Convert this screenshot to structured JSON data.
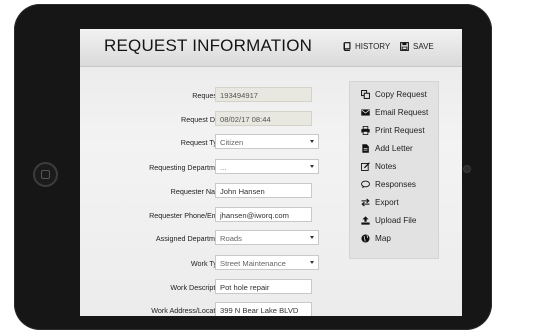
{
  "header": {
    "title": "REQUEST INFORMATION",
    "history_label": "HISTORY",
    "save_label": "SAVE"
  },
  "form": {
    "fields": [
      {
        "label": "Request #:",
        "value": "193494917",
        "kind": "readonly"
      },
      {
        "label": "Request Date:",
        "value": "08/02/17 08:44",
        "kind": "readonly"
      },
      {
        "label": "Request Type:",
        "value": "Citizen",
        "kind": "select"
      },
      {
        "label": "Requesting Department:",
        "value": "...",
        "kind": "select"
      },
      {
        "label": "Requester Name:",
        "value": "John Hansen",
        "kind": "text"
      },
      {
        "label": "Requester Phone/Email:",
        "value": "jhansen@iworq.com",
        "kind": "text"
      },
      {
        "label": "Assigned Department:",
        "value": "Roads",
        "kind": "select"
      },
      {
        "label": "Work Type:",
        "value": "Street Maintenance",
        "kind": "select"
      },
      {
        "label": "Work Description:",
        "value": "Pot hole repair",
        "kind": "text"
      },
      {
        "label": "Work Address/Location:",
        "value": "399 N Bear Lake BLVD",
        "kind": "text"
      }
    ]
  },
  "actions": [
    {
      "label": "Copy Request",
      "icon": "copy-icon"
    },
    {
      "label": "Email Request",
      "icon": "envelope-icon"
    },
    {
      "label": "Print Request",
      "icon": "printer-icon"
    },
    {
      "label": "Add Letter",
      "icon": "document-icon"
    },
    {
      "label": "Notes",
      "icon": "edit-icon"
    },
    {
      "label": "Responses",
      "icon": "comment-icon"
    },
    {
      "label": "Export",
      "icon": "exchange-icon"
    },
    {
      "label": "Upload File",
      "icon": "upload-icon"
    },
    {
      "label": "Map",
      "icon": "globe-icon"
    }
  ]
}
